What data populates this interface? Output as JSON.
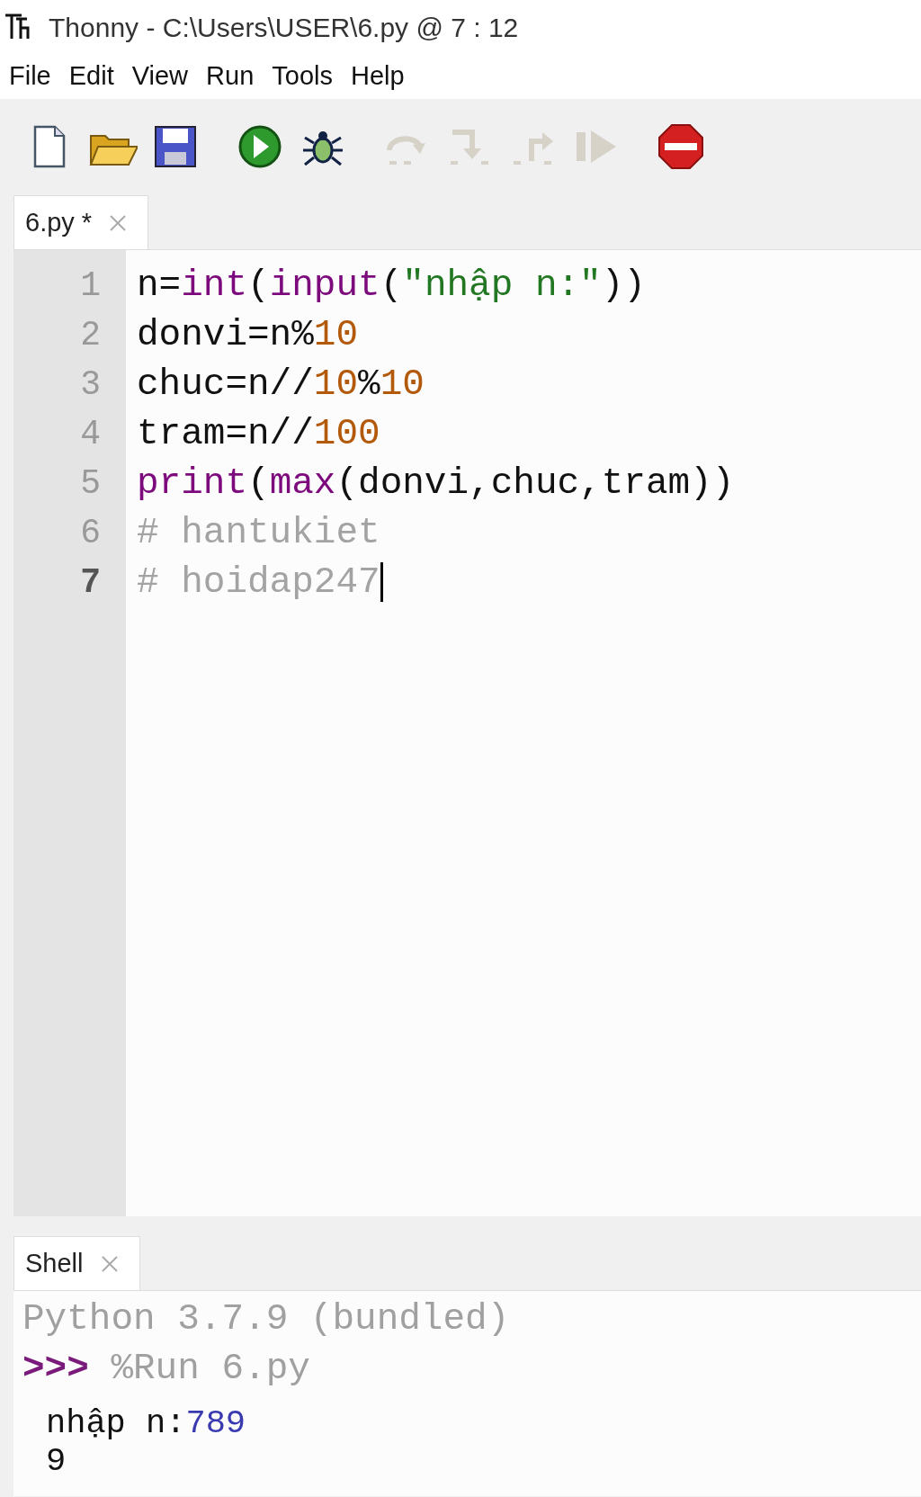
{
  "window": {
    "title": "Thonny  -  C:\\Users\\USER\\6.py  @  7 : 12"
  },
  "menu": [
    "File",
    "Edit",
    "View",
    "Run",
    "Tools",
    "Help"
  ],
  "toolbar": [
    {
      "kind": "new",
      "disabled": false
    },
    {
      "kind": "open",
      "disabled": false
    },
    {
      "kind": "save",
      "disabled": false
    },
    {
      "kind": "run",
      "disabled": false
    },
    {
      "kind": "debug",
      "disabled": false
    },
    {
      "kind": "step-over",
      "disabled": true
    },
    {
      "kind": "step-into",
      "disabled": true
    },
    {
      "kind": "step-out",
      "disabled": true
    },
    {
      "kind": "resume",
      "disabled": true
    },
    {
      "kind": "stop",
      "disabled": false
    }
  ],
  "editor_tabs": [
    {
      "label": "6.py *",
      "selected": true
    }
  ],
  "editor": {
    "lines": [
      {
        "number": "1",
        "current": false,
        "tokens": [
          {
            "text": "n=",
            "kind": "plain"
          },
          {
            "text": "int",
            "kind": "builtin"
          },
          {
            "text": "(",
            "kind": "plain"
          },
          {
            "text": "input",
            "kind": "builtin"
          },
          {
            "text": "(",
            "kind": "plain"
          },
          {
            "text": "\"nhập n:\"",
            "kind": "string"
          },
          {
            "text": "))",
            "kind": "plain"
          }
        ]
      },
      {
        "number": "2",
        "current": false,
        "tokens": [
          {
            "text": "donvi=n%",
            "kind": "plain"
          },
          {
            "text": "10",
            "kind": "number"
          }
        ]
      },
      {
        "number": "3",
        "current": false,
        "tokens": [
          {
            "text": "chuc=n//",
            "kind": "plain"
          },
          {
            "text": "10",
            "kind": "number"
          },
          {
            "text": "%",
            "kind": "plain"
          },
          {
            "text": "10",
            "kind": "number"
          }
        ]
      },
      {
        "number": "4",
        "current": false,
        "tokens": [
          {
            "text": "tram=n//",
            "kind": "plain"
          },
          {
            "text": "100",
            "kind": "number"
          }
        ]
      },
      {
        "number": "5",
        "current": false,
        "tokens": [
          {
            "text": "print",
            "kind": "builtin"
          },
          {
            "text": "(",
            "kind": "plain"
          },
          {
            "text": "max",
            "kind": "builtin"
          },
          {
            "text": "(donvi,chuc,tram))",
            "kind": "plain"
          }
        ]
      },
      {
        "number": "6",
        "current": false,
        "tokens": [
          {
            "text": "# hantukiet",
            "kind": "comment"
          }
        ]
      },
      {
        "number": "7",
        "current": true,
        "tokens": [
          {
            "text": "# hoidap247",
            "kind": "comment"
          }
        ]
      }
    ]
  },
  "shell_tabs": [
    {
      "label": "Shell",
      "selected": true
    }
  ],
  "shell": {
    "lines": [
      {
        "kind": "banner",
        "text": "Python 3.7.9 (bundled)"
      },
      {
        "kind": "command",
        "prompt": ">>>",
        "text": "%Run 6.py"
      },
      {
        "kind": "output",
        "text": "nhập n:",
        "input": "789"
      },
      {
        "kind": "output",
        "text": "9"
      }
    ]
  }
}
